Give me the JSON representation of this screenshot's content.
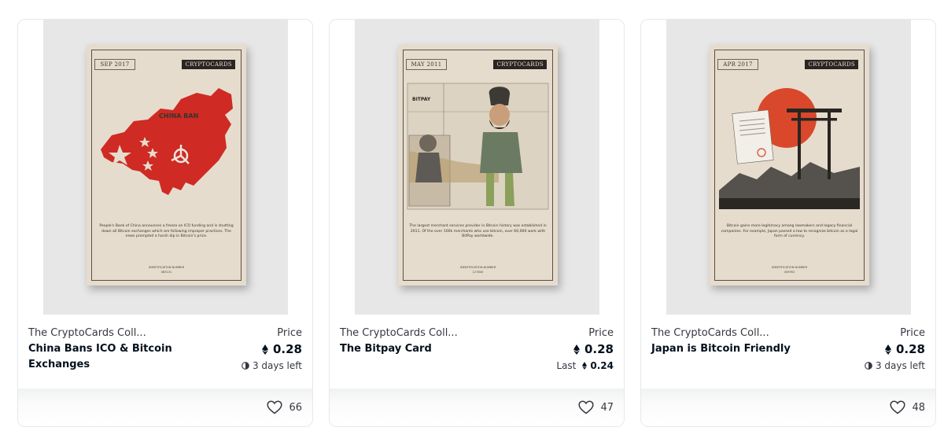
{
  "cards": [
    {
      "collection": "The CryptoCards Coll...",
      "title": "China Bans ICO & Bitcoin Exchanges",
      "price_label": "Price",
      "price": "0.28",
      "time_left": "3 days left",
      "likes": "66",
      "poster": {
        "date": "SEP 2017",
        "brand": "CRYPTOCARDS",
        "art_label": "CHINA BAN",
        "caption": "People's Bank of China announces a freeze on ICO funding and is shutting down all Bitcoin exchanges which are following improper practices. The news prompted a harsh dip in Bitcoin's price.",
        "id_label": "IDENTIFICATION NUMBER",
        "id": "483131"
      }
    },
    {
      "collection": "The CryptoCards Coll...",
      "title": "The Bitpay Card",
      "price_label": "Price",
      "price": "0.28",
      "last_label": "Last",
      "last_price": "0.24",
      "likes": "47",
      "poster": {
        "date": "MAY 2011",
        "brand": "CRYPTOCARDS",
        "art_label": "BITPAY",
        "caption": "The largest merchant services provider in Bitcoin history was established in 2011. Of the over 100k merchants who use bitcoin, over 60,000 work with BitPay worldwide.",
        "id_label": "IDENTIFICATION NUMBER",
        "id": "127840"
      }
    },
    {
      "collection": "The CryptoCards Coll...",
      "title": "Japan is Bitcoin Friendly",
      "price_label": "Price",
      "price": "0.28",
      "time_left": "3 days left",
      "likes": "48",
      "poster": {
        "date": "APR 2017",
        "brand": "CRYPTOCARDS",
        "caption": "Bitcoin gains more legitimacy among lawmakers and legacy financial companies. For example, Japan passed a law to recognize bitcoin as a legal form of currency.",
        "id_label": "IDENTIFICATION NUMBER",
        "id": "455952"
      }
    }
  ]
}
